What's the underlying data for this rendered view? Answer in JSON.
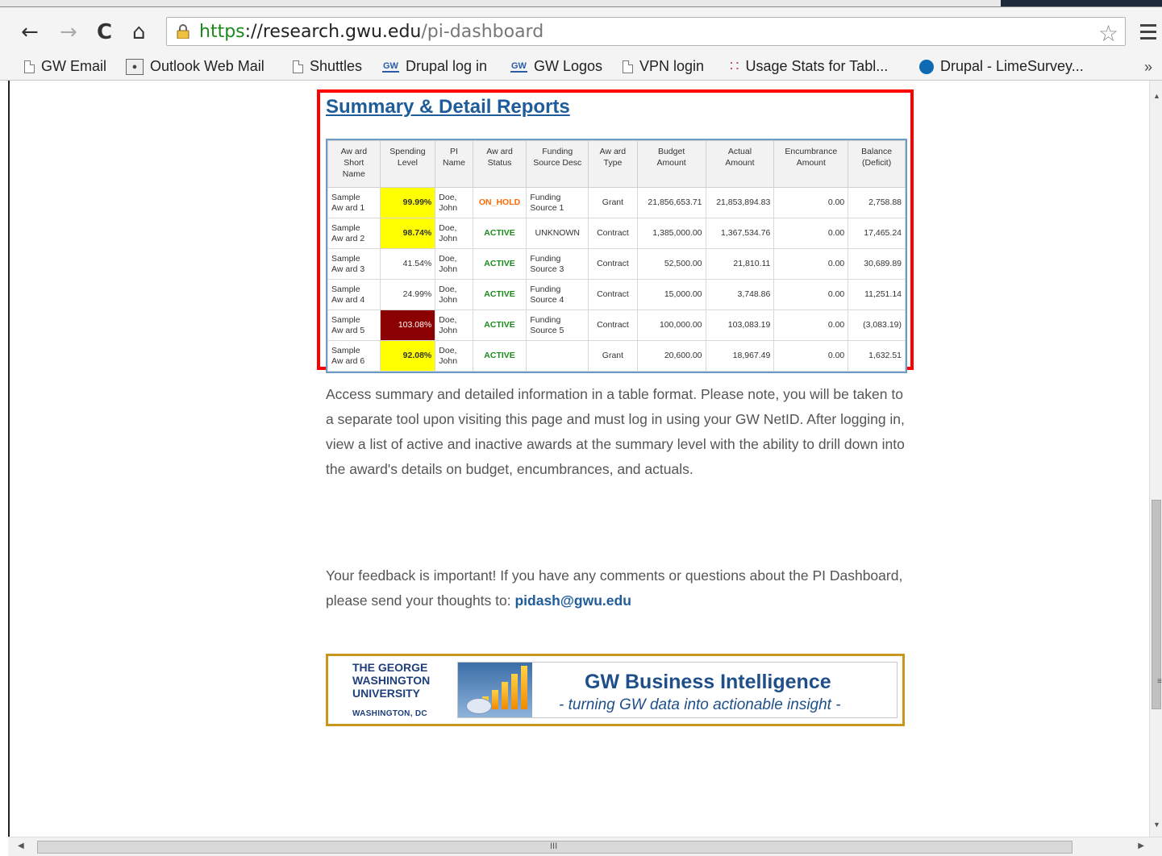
{
  "browser": {
    "url_scheme": "https",
    "url_host": "://research.gwu.edu",
    "url_path": "/pi-dashboard",
    "bookmarks": [
      {
        "label": "GW Email",
        "icon": "document-icon"
      },
      {
        "label": "Outlook Web Mail",
        "icon": "owa-icon"
      },
      {
        "label": "Shuttles",
        "icon": "document-icon"
      },
      {
        "label": "Drupal log in",
        "icon": "gw-icon"
      },
      {
        "label": "GW Logos",
        "icon": "gw-icon"
      },
      {
        "label": "VPN login",
        "icon": "document-icon"
      },
      {
        "label": "Usage Stats for Tabl...",
        "icon": "dots-icon"
      },
      {
        "label": "Drupal - LimeSurvey...",
        "icon": "drupal-icon"
      }
    ],
    "overflow": "»"
  },
  "section": {
    "title": "Summary & Detail Reports"
  },
  "report": {
    "headers": [
      [
        "Aw ard",
        "Short",
        "Name"
      ],
      [
        "Spending",
        "Level"
      ],
      [
        "PI",
        "Name"
      ],
      [
        "Aw ard",
        "Status"
      ],
      [
        "Funding",
        "Source Desc"
      ],
      [
        "Aw ard",
        "Type"
      ],
      [
        "Budget",
        "Amount"
      ],
      [
        "Actual",
        "Amount"
      ],
      [
        "Encumbrance",
        "Amount"
      ],
      [
        "Balance",
        "(Deficit)"
      ]
    ],
    "rows": [
      {
        "name1": "Sample",
        "name2": "Aw ard 1",
        "level": "99.99%",
        "level_style": "yellow",
        "pi1": "Doe,",
        "pi2": "John",
        "status": "ON_HOLD",
        "status_color": "#ff6a00",
        "source1": "Funding",
        "source2": "Source 1",
        "type": "Grant",
        "budget": "21,856,653.71",
        "actual": "21,853,894.83",
        "encumbrance": "0.00",
        "balance": "2,758.88"
      },
      {
        "name1": "Sample",
        "name2": "Aw ard 2",
        "level": "98.74%",
        "level_style": "yellow",
        "pi1": "Doe,",
        "pi2": "John",
        "status": "ACTIVE",
        "status_color": "#1a8a1a",
        "source1": "UNKNOWN",
        "source2": "",
        "type": "Contract",
        "budget": "1,385,000.00",
        "actual": "1,367,534.76",
        "encumbrance": "0.00",
        "balance": "17,465.24"
      },
      {
        "name1": "Sample",
        "name2": "Aw ard 3",
        "level": "41.54%",
        "level_style": "none",
        "pi1": "Doe,",
        "pi2": "John",
        "status": "ACTIVE",
        "status_color": "#1a8a1a",
        "source1": "Funding",
        "source2": "Source 3",
        "type": "Contract",
        "budget": "52,500.00",
        "actual": "21,810.11",
        "encumbrance": "0.00",
        "balance": "30,689.89"
      },
      {
        "name1": "Sample",
        "name2": "Aw ard 4",
        "level": "24.99%",
        "level_style": "none",
        "pi1": "Doe,",
        "pi2": "John",
        "status": "ACTIVE",
        "status_color": "#1a8a1a",
        "source1": "Funding",
        "source2": "Source 4",
        "type": "Contract",
        "budget": "15,000.00",
        "actual": "3,748.86",
        "encumbrance": "0.00",
        "balance": "11,251.14"
      },
      {
        "name1": "Sample",
        "name2": "Aw ard 5",
        "level": "103.08%",
        "level_style": "red",
        "pi1": "Doe,",
        "pi2": "John",
        "status": "ACTIVE",
        "status_color": "#1a8a1a",
        "source1": "Funding",
        "source2": "Source 5",
        "type": "Contract",
        "budget": "100,000.00",
        "actual": "103,083.19",
        "encumbrance": "0.00",
        "balance": "(3,083.19)"
      },
      {
        "name1": "Sample",
        "name2": "Aw ard 6",
        "level": "92.08%",
        "level_style": "yellow",
        "pi1": "Doe,",
        "pi2": "John",
        "status": "ACTIVE",
        "status_color": "#1a8a1a",
        "source1": "",
        "source2": "",
        "type": "Grant",
        "budget": "20,600.00",
        "actual": "18,967.49",
        "encumbrance": "0.00",
        "balance": "1,632.51"
      }
    ]
  },
  "content": {
    "paragraph1": "Access summary and detailed information in a table format.  Please note, you will be taken to a separate tool upon visiting this page and must log in using your GW NetID.  After logging in, view a list of active and inactive awards at the summary level with the ability to drill down into the award's details on budget, encumbrances, and actuals.",
    "paragraph2_text": "Your feedback is important!  If you have any comments or questions about the PI Dashboard, please send your thoughts to: ",
    "email": "pidash@gwu.edu"
  },
  "banner": {
    "logo_line1": "THE GEORGE",
    "logo_line2": "WASHINGTON",
    "logo_line3": "UNIVERSITY",
    "logo_line4": "WASHINGTON, DC",
    "title": "GW Business Intelligence",
    "subtitle": "- turning GW data into actionable insight -"
  },
  "colors": {
    "highlight_box": "#ff0000",
    "link": "#1f5c9a",
    "spending_warn": "#ffff00",
    "spending_over": "#8b0000",
    "banner_border": "#c8961e"
  }
}
